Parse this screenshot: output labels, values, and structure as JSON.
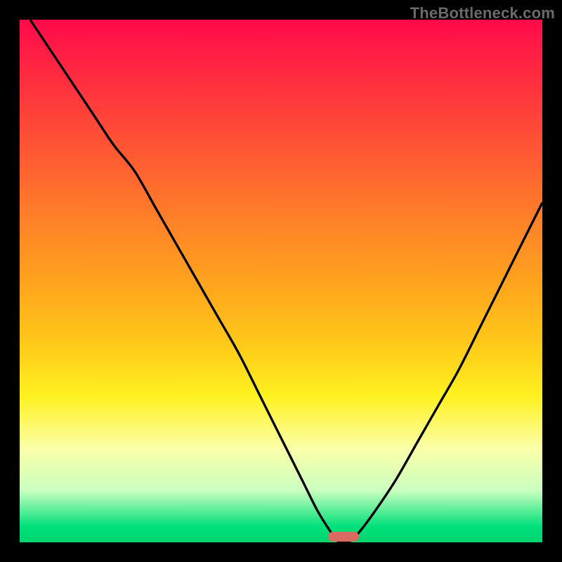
{
  "watermark": "TheBottleneck.com",
  "colors": {
    "frame": "#000000",
    "curve": "#000000",
    "marker": "#db6b62",
    "watermark_text": "#6a6a6a"
  },
  "chart_data": {
    "type": "line",
    "title": "",
    "xlabel": "",
    "ylabel": "",
    "xlim": [
      0,
      100
    ],
    "ylim": [
      0,
      100
    ],
    "grid": false,
    "legend": false,
    "series": [
      {
        "name": "bottleneck-curve-left",
        "x": [
          2,
          6,
          10,
          14,
          18,
          22,
          26,
          30,
          34,
          38,
          42,
          46,
          50,
          54,
          57,
          59.5,
          61
        ],
        "y": [
          100,
          94,
          88,
          82,
          76,
          71,
          64,
          57,
          50,
          43,
          36,
          28,
          20,
          12,
          6,
          2,
          0
        ]
      },
      {
        "name": "bottleneck-curve-right",
        "x": [
          63,
          65,
          68,
          72,
          76,
          80,
          84,
          88,
          92,
          96,
          100
        ],
        "y": [
          0,
          2,
          6,
          12,
          19,
          26,
          33,
          41,
          49,
          57,
          65
        ]
      }
    ],
    "marker": {
      "x": 62,
      "y": 0,
      "label": ""
    },
    "background_gradient_stops": [
      {
        "pct": 0,
        "color": "#ff0a4a"
      },
      {
        "pct": 12,
        "color": "#ff2f3f"
      },
      {
        "pct": 26,
        "color": "#ff5a33"
      },
      {
        "pct": 38,
        "color": "#ff8028"
      },
      {
        "pct": 50,
        "color": "#ffa21e"
      },
      {
        "pct": 62,
        "color": "#ffc919"
      },
      {
        "pct": 72,
        "color": "#fff120"
      },
      {
        "pct": 82,
        "color": "#fbffa8"
      },
      {
        "pct": 90,
        "color": "#ccffc0"
      },
      {
        "pct": 97,
        "color": "#00e07a"
      },
      {
        "pct": 100,
        "color": "#00d46f"
      }
    ]
  }
}
